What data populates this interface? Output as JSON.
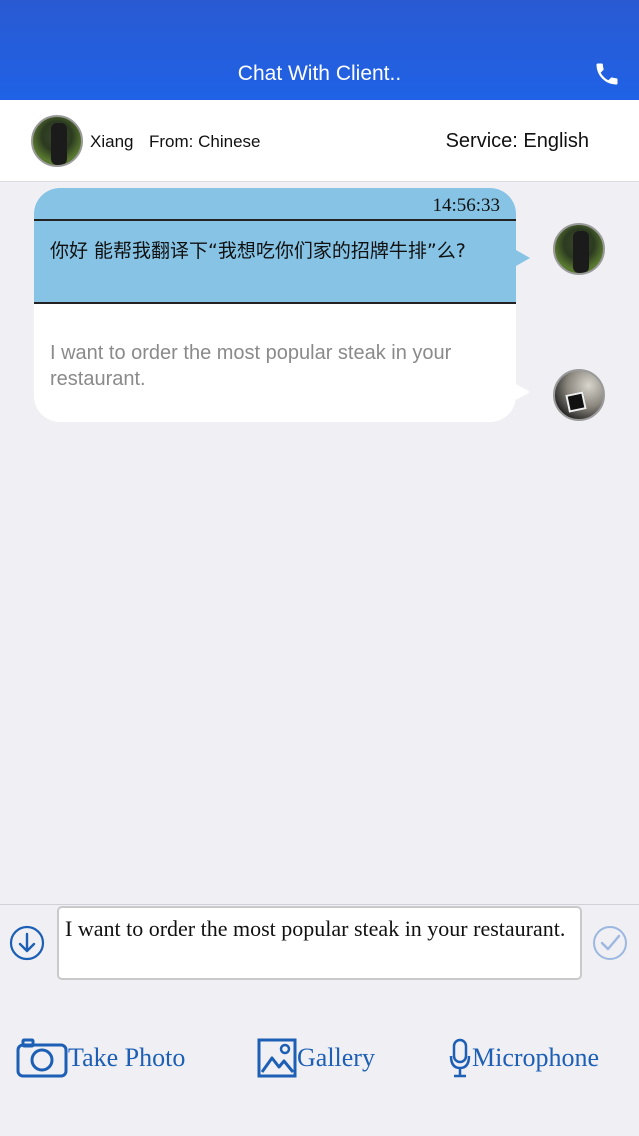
{
  "header": {
    "title": "Chat With Client..",
    "call_icon": "phone-icon"
  },
  "client": {
    "name": "Xiang",
    "from": "From: Chinese",
    "service": "Service: English"
  },
  "message": {
    "time": "14:56:33",
    "original": "你好 能帮我翻译下“我想吃你们家的招牌牛排”么?",
    "translation": "I want to order the most popular steak in your restaurant."
  },
  "composer": {
    "value": "I want to order the most popular steak in your restaurant."
  },
  "actions": {
    "take_photo": "Take Photo",
    "gallery": "Gallery",
    "microphone": "Microphone"
  },
  "colors": {
    "header": "#1f62e6",
    "bubble_original": "#86c3e4",
    "action_text": "#1d5fb4",
    "check": "#9cb8e0"
  }
}
